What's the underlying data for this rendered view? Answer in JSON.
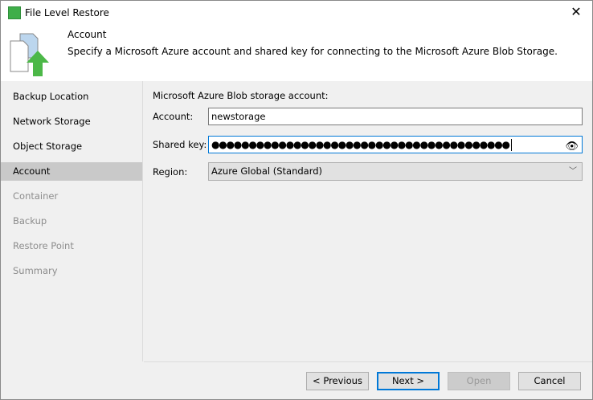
{
  "window": {
    "title": "File Level Restore"
  },
  "header": {
    "title": "Account",
    "description": "Specify a Microsoft Azure account and shared key for connecting to the Microsoft Azure Blob Storage."
  },
  "nav": {
    "items": [
      {
        "label": "Backup Location",
        "state": "enabled"
      },
      {
        "label": "Network Storage",
        "state": "enabled"
      },
      {
        "label": "Object Storage",
        "state": "enabled"
      },
      {
        "label": "Account",
        "state": "selected"
      },
      {
        "label": "Container",
        "state": "disabled"
      },
      {
        "label": "Backup",
        "state": "disabled"
      },
      {
        "label": "Restore Point",
        "state": "disabled"
      },
      {
        "label": "Summary",
        "state": "disabled"
      }
    ]
  },
  "form": {
    "section_label": "Microsoft Azure Blob storage account:",
    "account_label": "Account:",
    "account_value": "newstorage",
    "shared_key_label": "Shared key:",
    "shared_key_masked": "●●●●●●●●●●●●●●●●●●●●●●●●●●●●●●●●●●●●●●●●",
    "region_label": "Region:",
    "region_value": "Azure Global (Standard)"
  },
  "buttons": {
    "previous": "< Previous",
    "next": "Next >",
    "open": "Open",
    "cancel": "Cancel"
  },
  "colors": {
    "accent": "#0078d7",
    "selected_nav": "#c9c9c9",
    "brand_green": "#3fae49"
  }
}
